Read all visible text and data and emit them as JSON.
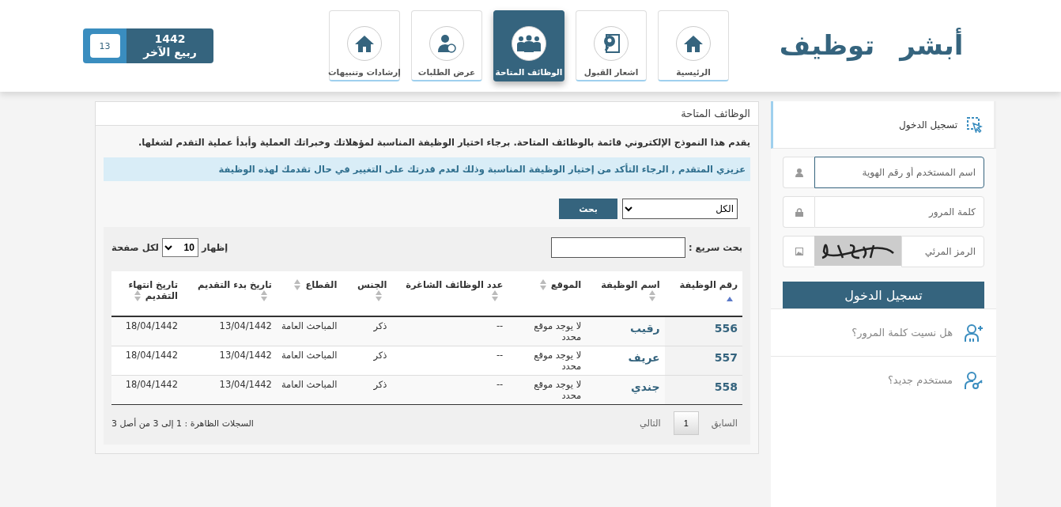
{
  "logo": {
    "first": "أبشر",
    "second": "توظيف"
  },
  "nav": [
    {
      "label": "الرئيسية",
      "selected": false
    },
    {
      "label": "اشعار القبول",
      "selected": false
    },
    {
      "label": "الوظائف المتاحة",
      "selected": true
    },
    {
      "label": "عرض الطلبات",
      "selected": false
    },
    {
      "label": "إرشادات وتنبيهات",
      "selected": false
    }
  ],
  "date_badge": {
    "year": "1442",
    "month": "ربيع الآخر",
    "day": "13"
  },
  "login": {
    "title": "تسجيل الدخول",
    "fields": [
      {
        "kind": "text",
        "placeholder": "اسم المستخدم أو رقم الهوية",
        "focused": true
      },
      {
        "kind": "password",
        "placeholder": "كلمة المرور",
        "focused": false
      },
      {
        "kind": "captcha",
        "placeholder": "الرمز المرئي",
        "focused": false
      }
    ],
    "submit": "تسجيل الدخول",
    "links": [
      "هل نسيت كلمة المرور؟",
      "مستخدم جديد؟"
    ]
  },
  "panel": {
    "title": "الوظائف المتاحة",
    "intro": "يقدم هذا النموذج الإلكتروني قائمة بالوظائف المتاحة. برجاء اختيار الوظيفة المناسبة لمؤهلاتك وخبراتك العملية وأبدأ عملية التقدم لشغلها.",
    "notice": "عزيزي المتقدم , الرجاء التأكد من إختيار الوظيفة المناسبة وذلك لعدم قدرتك على التغيير في حال تقدمك لهذه الوظيفة",
    "filter": {
      "value": "الكل",
      "button": "بحث"
    },
    "quick_search": {
      "label": "بحث سريع :"
    },
    "page_size": {
      "before": "إظهار",
      "value": "10",
      "after": "لكل صفحة"
    },
    "table": {
      "columns": [
        {
          "label": "رقم الوظيفة",
          "sorted": true
        },
        {
          "label": "اسم الوظيفة",
          "sorted": false
        },
        {
          "label": "الموقع",
          "sorted": false
        },
        {
          "label": "عدد الوظائف الشاغرة",
          "sorted": false
        },
        {
          "label": "الجنس",
          "sorted": false
        },
        {
          "label": "القطاع",
          "sorted": false
        },
        {
          "label": "تاريخ بدء التقديم",
          "sorted": false
        },
        {
          "label": "تاريخ انتهاء التقديم",
          "sorted": false
        }
      ],
      "rows": [
        [
          "556",
          "رقيب",
          "لا يوجد موقع محدد",
          "--",
          "ذكر",
          "المباحث العامة",
          "13/04/1442",
          "18/04/1442"
        ],
        [
          "557",
          "عريف",
          "لا يوجد موقع محدد",
          "--",
          "ذكر",
          "المباحث العامة",
          "13/04/1442",
          "18/04/1442"
        ],
        [
          "558",
          "جندي",
          "لا يوجد موقع محدد",
          "--",
          "ذكر",
          "المباحث العامة",
          "13/04/1442",
          "18/04/1442"
        ]
      ]
    },
    "pagination": {
      "previous": "السابق",
      "pages": [
        {
          "label": "1",
          "selected": true
        }
      ],
      "next": "التالي"
    },
    "summary": "السجلات الظاهرة : 1 إلى 3 من أصل 3"
  }
}
